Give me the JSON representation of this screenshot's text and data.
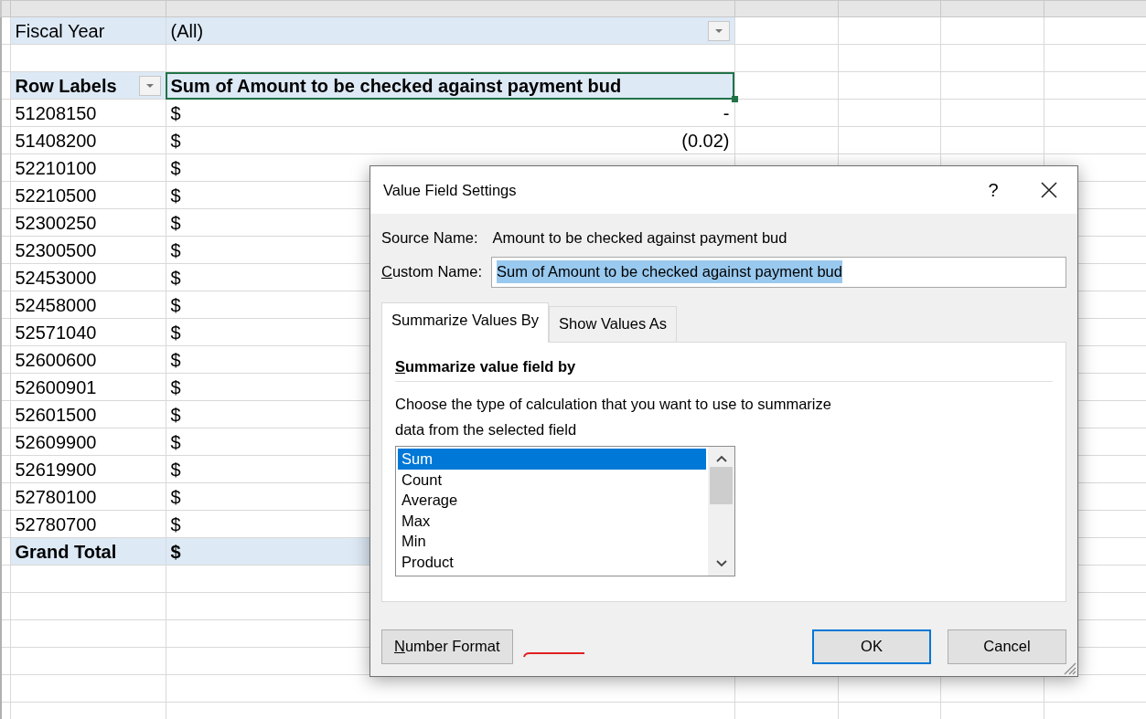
{
  "filter": {
    "label": "Fiscal Year",
    "value": "(All)"
  },
  "pivot": {
    "row_header": "Row Labels",
    "value_header": "Sum of Amount to be checked against payment bud",
    "rows": [
      {
        "label": "51208150",
        "currency": "$",
        "value": "-"
      },
      {
        "label": "51408200",
        "currency": "$",
        "value": "(0.02)"
      },
      {
        "label": "52210100",
        "currency": "$"
      },
      {
        "label": "52210500",
        "currency": "$"
      },
      {
        "label": "52300250",
        "currency": "$"
      },
      {
        "label": "52300500",
        "currency": "$"
      },
      {
        "label": "52453000",
        "currency": "$"
      },
      {
        "label": "52458000",
        "currency": "$"
      },
      {
        "label": "52571040",
        "currency": "$"
      },
      {
        "label": "52600600",
        "currency": "$"
      },
      {
        "label": "52600901",
        "currency": "$"
      },
      {
        "label": "52601500",
        "currency": "$"
      },
      {
        "label": "52609900",
        "currency": "$"
      },
      {
        "label": "52619900",
        "currency": "$"
      },
      {
        "label": "52780100",
        "currency": "$"
      },
      {
        "label": "52780700",
        "currency": "$"
      }
    ],
    "total": {
      "label": "Grand Total",
      "currency": "$"
    }
  },
  "dialog": {
    "title": "Value Field Settings",
    "help": "?",
    "source_label": "Source Name:",
    "source_name": "Amount to be checked against payment bud",
    "custom_label": {
      "text": "Custom Name:",
      "underline_first": true
    },
    "custom_name": "Sum of Amount to be checked against payment bud",
    "tabs": [
      {
        "label": "Summarize Values By",
        "selected": true
      },
      {
        "label": "Show Values As",
        "selected": false
      }
    ],
    "section_title": {
      "text": "Summarize value field by",
      "underline_first": true
    },
    "description_lines": [
      "Choose the type of calculation that you want to use to summarize",
      "data from the selected field"
    ],
    "functions": [
      {
        "label": "Sum",
        "selected": true
      },
      {
        "label": "Count",
        "selected": false
      },
      {
        "label": "Average",
        "selected": false
      },
      {
        "label": "Max",
        "selected": false
      },
      {
        "label": "Min",
        "selected": false
      },
      {
        "label": "Product",
        "selected": false
      }
    ],
    "buttons": [
      {
        "label": "Number Format",
        "kind": "secondary",
        "underline_first": true
      },
      {
        "label": "OK",
        "kind": "default",
        "underline_first": false
      },
      {
        "label": "Cancel",
        "kind": "secondary",
        "underline_first": false
      }
    ]
  }
}
